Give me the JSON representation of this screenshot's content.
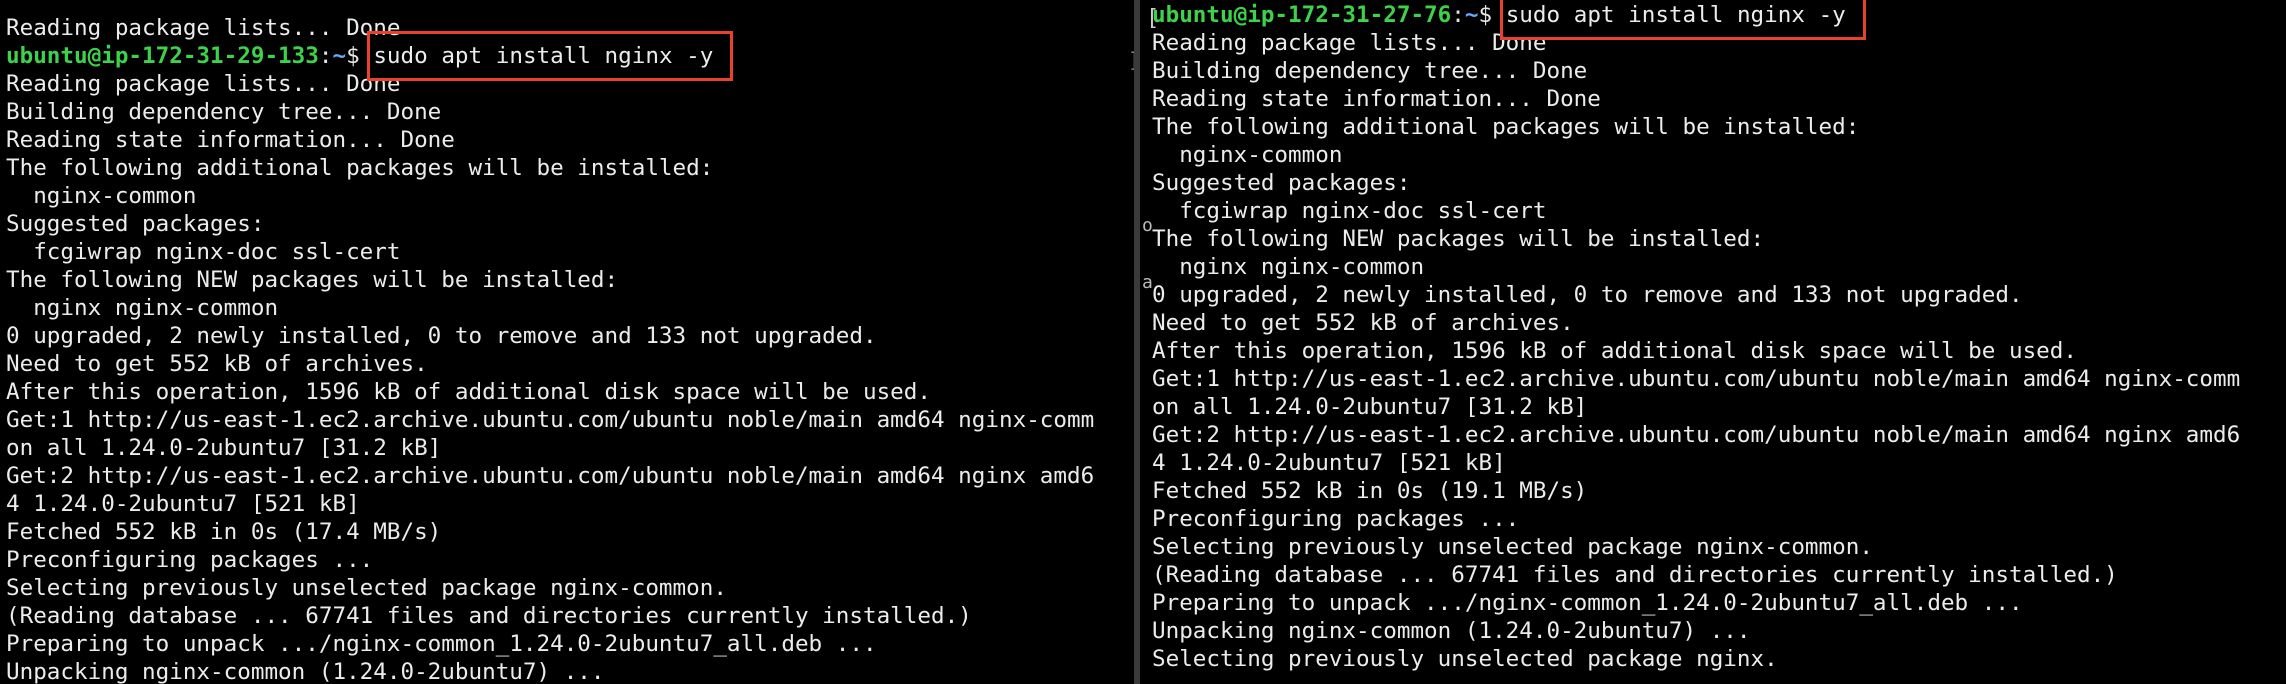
{
  "left_terminal": {
    "line_before": "Reading package lists... Done",
    "prompt": {
      "user_host": "ubuntu@ip-172-31-29-133",
      "sep": ":",
      "path": "~",
      "dollar": "$ ",
      "command": "sudo apt install nginx -y"
    },
    "output": [
      "Reading package lists... Done",
      "Building dependency tree... Done",
      "Reading state information... Done",
      "The following additional packages will be installed:",
      "  nginx-common",
      "Suggested packages:",
      "  fcgiwrap nginx-doc ssl-cert",
      "The following NEW packages will be installed:",
      "  nginx nginx-common",
      "0 upgraded, 2 newly installed, 0 to remove and 133 not upgraded.",
      "Need to get 552 kB of archives.",
      "After this operation, 1596 kB of additional disk space will be used.",
      "Get:1 http://us-east-1.ec2.archive.ubuntu.com/ubuntu noble/main amd64 nginx-comm",
      "on all 1.24.0-2ubuntu7 [31.2 kB]",
      "Get:2 http://us-east-1.ec2.archive.ubuntu.com/ubuntu noble/main amd64 nginx amd6",
      "4 1.24.0-2ubuntu7 [521 kB]",
      "Fetched 552 kB in 0s (17.4 MB/s)",
      "Preconfiguring packages ...",
      "Selecting previously unselected package nginx-common.",
      "(Reading database ... 67741 files and directories currently installed.)",
      "Preparing to unpack .../nginx-common_1.24.0-2ubuntu7_all.deb ...",
      "Unpacking nginx-common (1.24.0-2ubuntu7) ..."
    ],
    "edge_mark": "]"
  },
  "right_terminal": {
    "prompt": {
      "bracket": "[",
      "user_host": "ubuntu@ip-172-31-27-76",
      "sep": ":",
      "path": "~",
      "dollar": "$ ",
      "command": "sudo apt install nginx -y"
    },
    "output": [
      "Reading package lists... Done",
      "Building dependency tree... Done",
      "Reading state information... Done",
      "The following additional packages will be installed:",
      "  nginx-common",
      "Suggested packages:",
      "  fcgiwrap nginx-doc ssl-cert",
      "The following NEW packages will be installed:",
      "  nginx nginx-common",
      "0 upgraded, 2 newly installed, 0 to remove and 133 not upgraded.",
      "Need to get 552 kB of archives.",
      "After this operation, 1596 kB of additional disk space will be used.",
      "Get:1 http://us-east-1.ec2.archive.ubuntu.com/ubuntu noble/main amd64 nginx-comm",
      "on all 1.24.0-2ubuntu7 [31.2 kB]",
      "Get:2 http://us-east-1.ec2.archive.ubuntu.com/ubuntu noble/main amd64 nginx amd6",
      "4 1.24.0-2ubuntu7 [521 kB]",
      "Fetched 552 kB in 0s (19.1 MB/s)",
      "Preconfiguring packages ...",
      "Selecting previously unselected package nginx-common.",
      "(Reading database ... 67741 files and directories currently installed.)",
      "Preparing to unpack .../nginx-common_1.24.0-2ubuntu7_all.deb ...",
      "Unpacking nginx-common (1.24.0-2ubuntu7) ...",
      "Selecting previously unselected package nginx."
    ],
    "edge_marks": [
      "o",
      "a"
    ]
  },
  "colors": {
    "background": "#000000",
    "prompt_user": "#3cd34a",
    "prompt_path": "#6aa7ff",
    "highlight_box": "#e8412c",
    "text": "#ececec"
  }
}
